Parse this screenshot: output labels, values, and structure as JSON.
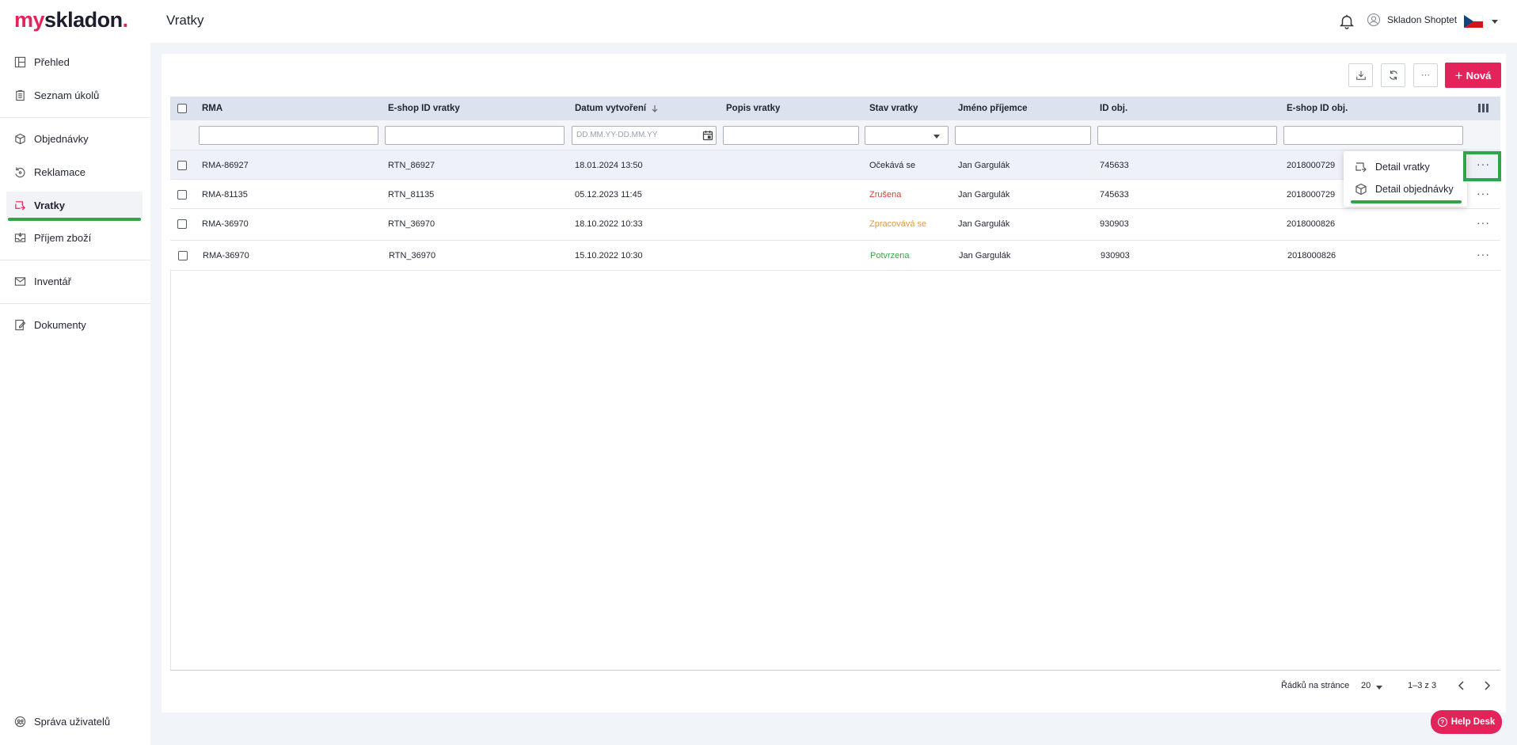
{
  "app": {
    "logo_prefix": "my",
    "logo_main": "skladon",
    "logo_dot": ".",
    "page_title": "Vratky"
  },
  "header": {
    "user_name": "Skladon Shoptet",
    "language_flag": "cz-flag-icon"
  },
  "sidebar": {
    "items": [
      {
        "label": "Přehled",
        "icon": "layout-icon"
      },
      {
        "label": "Seznam úkolů",
        "icon": "clipboard-icon"
      },
      {
        "label": "Objednávky",
        "icon": "box-icon"
      },
      {
        "label": "Reklamace",
        "icon": "return-icon"
      },
      {
        "label": "Vratky",
        "icon": "returns-icon",
        "active": true
      },
      {
        "label": "Příjem zboží",
        "icon": "inbox-icon"
      },
      {
        "label": "Inventář",
        "icon": "mail-icon"
      },
      {
        "label": "Dokumenty",
        "icon": "document-edit-icon"
      },
      {
        "label": "Správa uživatelů",
        "icon": "users-icon"
      }
    ]
  },
  "toolbar": {
    "new_label": "Nová",
    "more_label": "···"
  },
  "table": {
    "columns": [
      "RMA",
      "E-shop ID vratky",
      "Datum vytvoření",
      "Popis vratky",
      "Stav vratky",
      "Jméno příjemce",
      "ID obj.",
      "E-shop ID obj."
    ],
    "date_placeholder": "DD.MM.YY-DD.MM.YY",
    "rows": [
      {
        "rma": "RMA-86927",
        "eshop_id": "RTN_86927",
        "date": "18.01.2024 13:50",
        "desc": "",
        "status": "Očekává se",
        "recipient": "Jan Gargulák",
        "order_id": "745633",
        "eshop_order_id": "2018000729"
      },
      {
        "rma": "RMA-81135",
        "eshop_id": "RTN_81135",
        "date": "05.12.2023 11:45",
        "desc": "",
        "status": "Zrušena",
        "recipient": "Jan Gargulák",
        "order_id": "745633",
        "eshop_order_id": "2018000729"
      },
      {
        "rma": "RMA-36970",
        "eshop_id": "RTN_36970",
        "date": "18.10.2022 10:33",
        "desc": "",
        "status": "Zpracovává se",
        "recipient": "Jan Gargulák",
        "order_id": "930903",
        "eshop_order_id": "2018000826"
      },
      {
        "rma": "RMA-36970",
        "eshop_id": "RTN_36970",
        "date": "15.10.2022 10:30",
        "desc": "",
        "status": "Potvrzena",
        "recipient": "Jan Gargulák",
        "order_id": "930903",
        "eshop_order_id": "2018000826"
      }
    ],
    "row_menu_label": "···"
  },
  "context_menu": {
    "items": [
      {
        "label": "Detail vratky",
        "icon": "returns-icon"
      },
      {
        "label": "Detail objednávky",
        "icon": "box-icon"
      }
    ]
  },
  "pagination": {
    "rows_per_page_label": "Řádků na stránce",
    "rows_per_page": "20",
    "range": "1–3 z 3"
  },
  "helpdesk": {
    "label": "Help Desk",
    "icon_glyph": "?"
  },
  "colors": {
    "accent": "#e2245a",
    "highlight": "#2ea54b",
    "status_red": "#d93b3b",
    "status_orange": "#e29a3a",
    "status_green": "#3aa648"
  }
}
